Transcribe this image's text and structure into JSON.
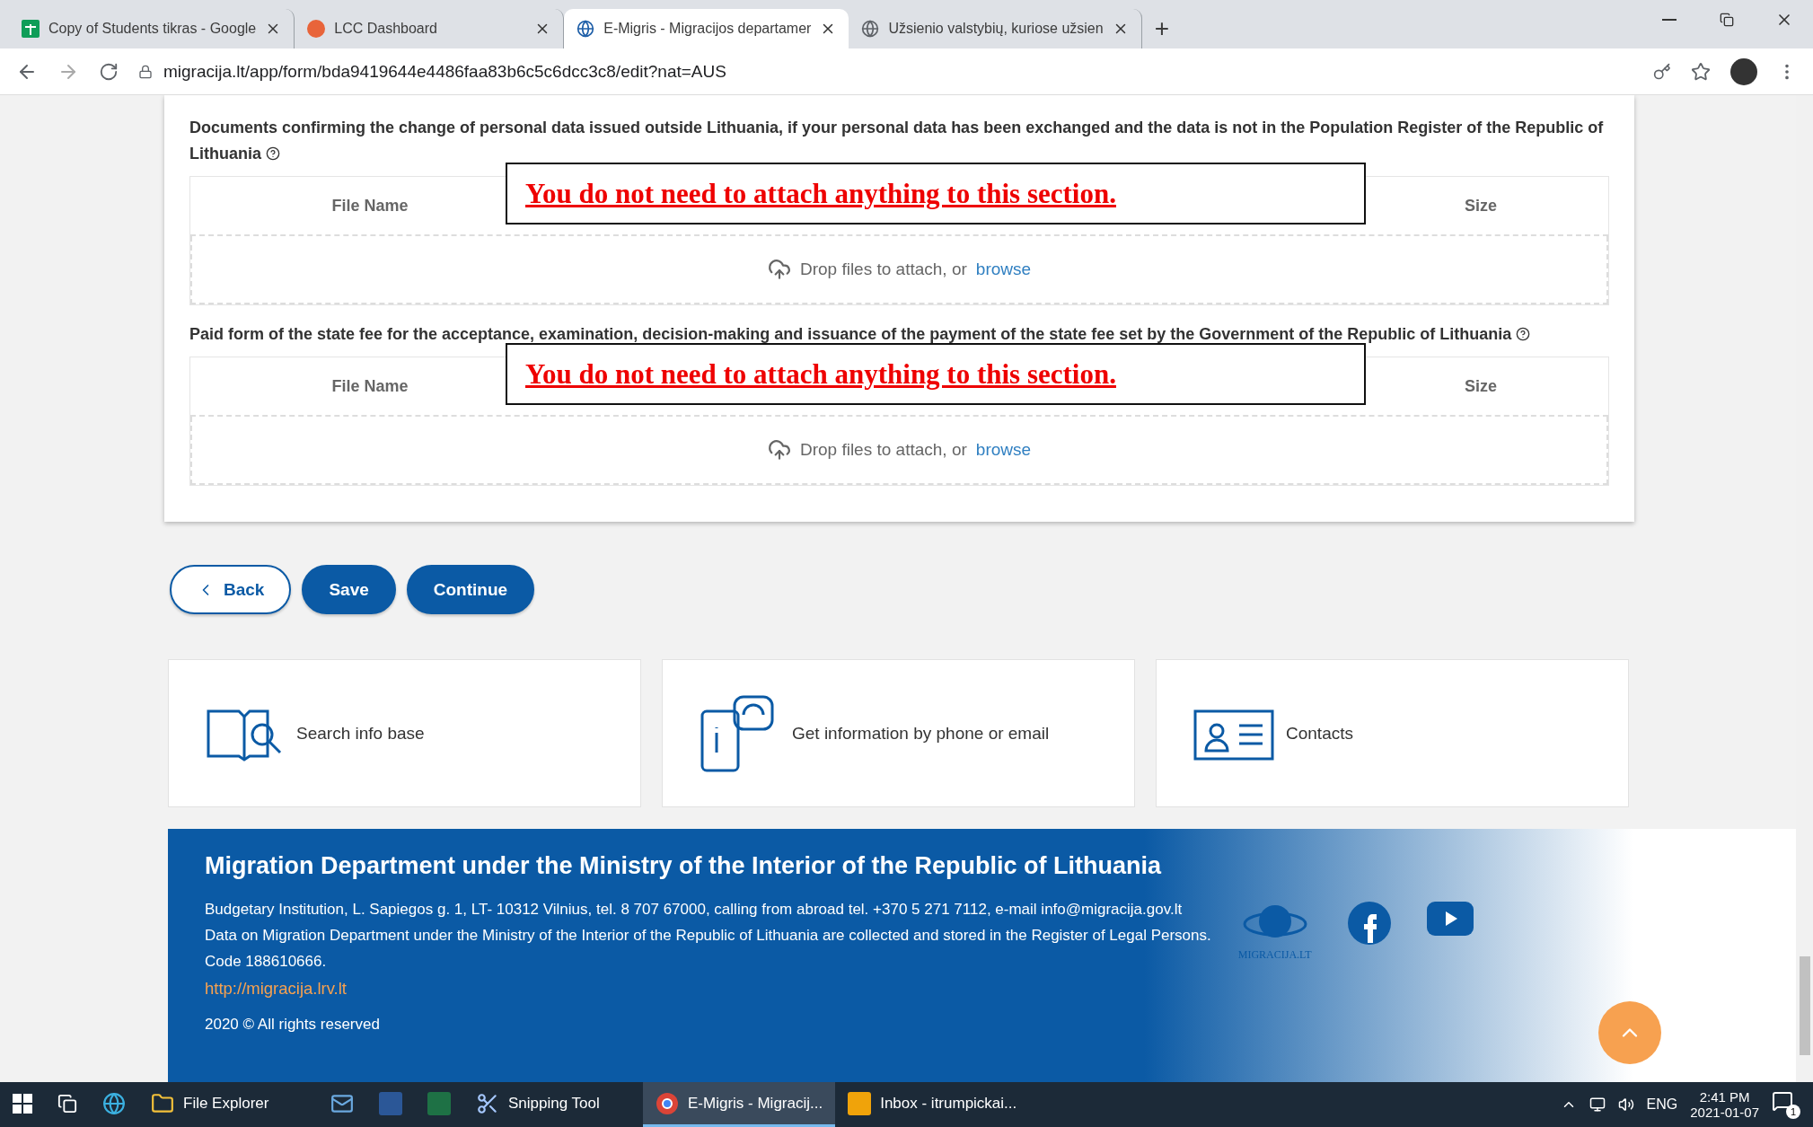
{
  "browser": {
    "tabs": [
      {
        "title": "Copy of Students tikras - Google",
        "selected": false
      },
      {
        "title": "LCC Dashboard",
        "selected": false
      },
      {
        "title": "E-Migris - Migracijos departamer",
        "selected": true
      },
      {
        "title": "Užsienio valstybių, kuriose užsien",
        "selected": false
      }
    ],
    "new_tab": "+",
    "url": "migracija.lt/app/form/bda9419644e4486faa83b6c5c6dcc3c8/edit?nat=AUS"
  },
  "sections": [
    {
      "label": "Documents confirming the change of personal data issued outside Lithuania, if your personal data has been exchanged and the data is not in the Population Register of the Republic of Lithuania",
      "columns": [
        "File Name",
        "Size"
      ],
      "drop_text": "Drop files to attach, or",
      "browse": "browse",
      "note": "You do not need to attach anything to this section."
    },
    {
      "label": "Paid form of the state fee for the acceptance, examination, decision-making and issuance of the payment of the state fee set by the Government of the Republic of Lithuania",
      "columns": [
        "File Name",
        "Size"
      ],
      "drop_text": "Drop files to attach, or",
      "browse": "browse",
      "note": "You do not need to attach anything to this section."
    }
  ],
  "buttons": [
    {
      "label": "Back",
      "kind": "outline"
    },
    {
      "label": "Save",
      "kind": "filled"
    },
    {
      "label": "Continue",
      "kind": "filled"
    }
  ],
  "info_cards": [
    {
      "label": "Search info base"
    },
    {
      "label": "Get information by phone or email"
    },
    {
      "label": "Contacts"
    }
  ],
  "footer": {
    "title": "Migration Department under the Ministry of the Interior of the Republic of Lithuania",
    "lines": [
      "Budgetary Institution, L. Sapiegos g. 1, LT- 10312 Vilnius, tel. 8 707 67000, calling from abroad tel. +370 5 271 7112, e-mail info@migracija.gov.lt",
      "Data on Migration Department under the Ministry of the Interior of the Republic of Lithuania are collected and stored in the Register of Legal Persons.",
      "Code 188610666."
    ],
    "link": "http://migracija.lrv.lt",
    "copyright": "2020 © All rights reserved",
    "logo_text": "MIGRACIJA.LT"
  },
  "taskbar": {
    "apps": [
      {
        "selected": false
      },
      {
        "selected": false
      },
      {
        "label": "File Explorer",
        "selected": false
      },
      {
        "selected": false
      },
      {
        "selected": false
      },
      {
        "selected": false
      },
      {
        "label": "Snipping Tool",
        "selected": false
      },
      {
        "label": "E-Migris - Migracij...",
        "selected": true
      },
      {
        "label": "Inbox - itrumpickai...",
        "selected": false
      }
    ],
    "lang": "ENG",
    "time": "2:41 PM",
    "date": "2021-01-07",
    "notifications": "1"
  }
}
